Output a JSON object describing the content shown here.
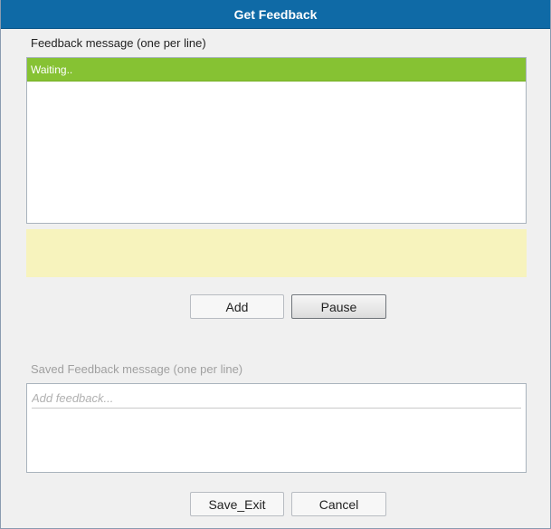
{
  "dialog": {
    "title": "Get Feedback"
  },
  "feedback": {
    "label": "Feedback message (one per line)",
    "items": [
      "Waiting.."
    ]
  },
  "buttons": {
    "add": "Add",
    "pause": "Pause",
    "save_exit": "Save_Exit",
    "cancel": "Cancel"
  },
  "saved": {
    "label": "Saved Feedback message (one per line)",
    "placeholder": "Add feedback..."
  },
  "colors": {
    "title_bar": "#0f6aa6",
    "selected_row": "#86c233",
    "notice_bg": "#f7f3bd"
  }
}
